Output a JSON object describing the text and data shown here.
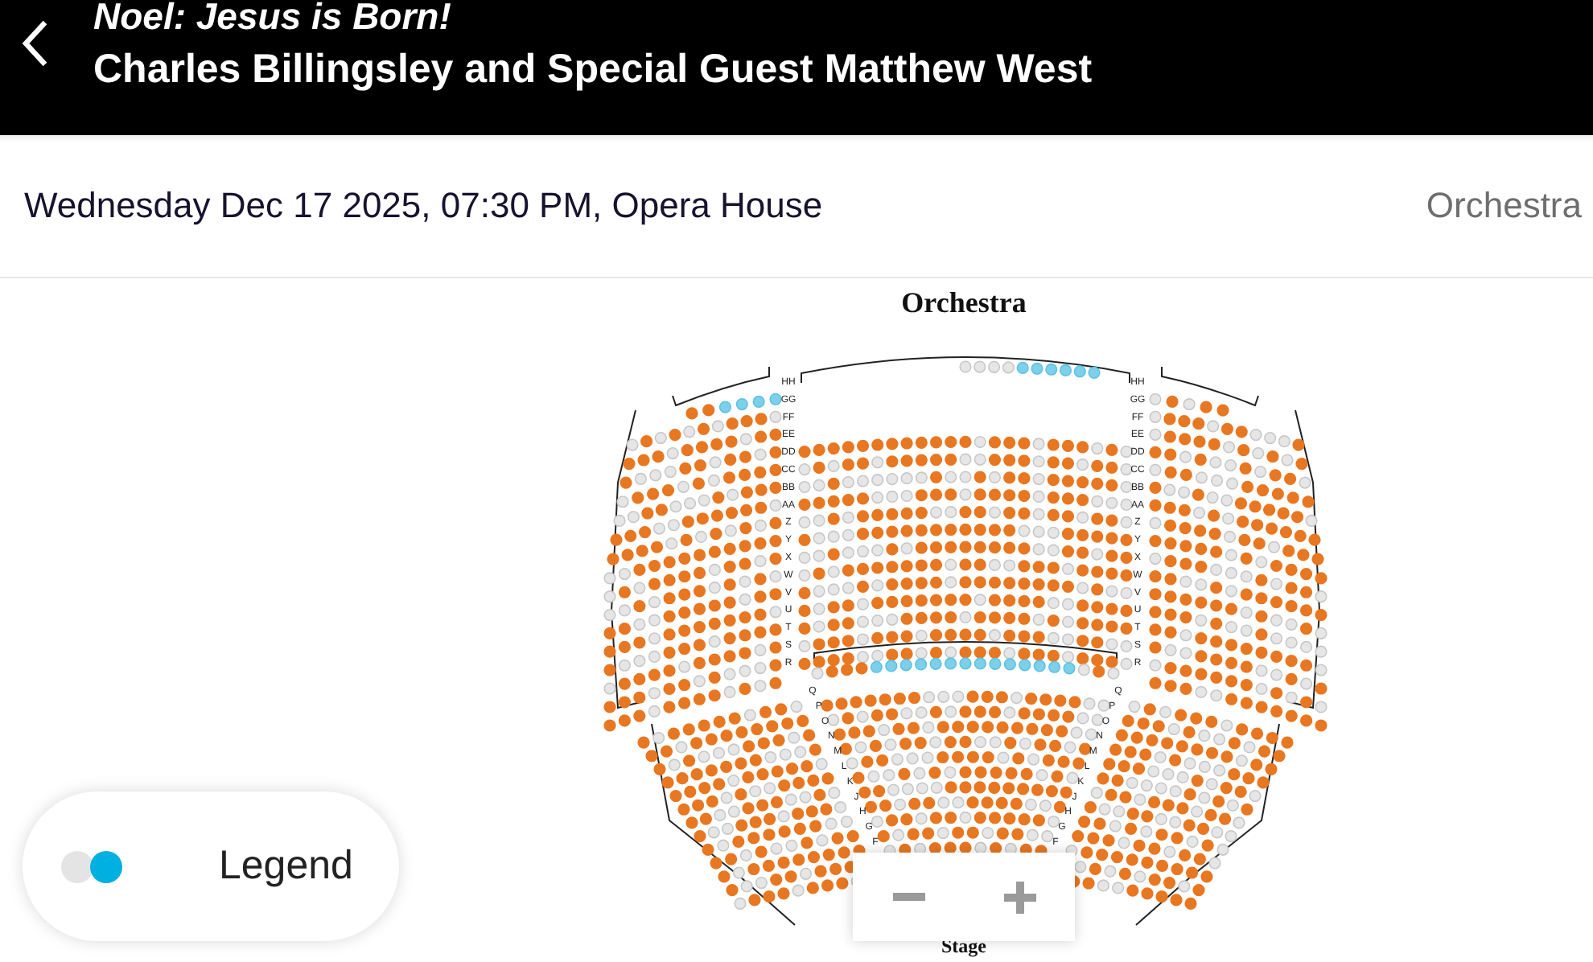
{
  "header": {
    "title": "Noel: Jesus is Born!",
    "subtitle": "Charles Billingsley and Special Guest Matthew West"
  },
  "event": {
    "details": "Wednesday Dec 17 2025, 07:30 PM, Opera House",
    "section": "Orchestra"
  },
  "map": {
    "title": "Orchestra",
    "upper_rows_left": [
      "HH",
      "GG",
      "FF",
      "EE",
      "DD",
      "CC",
      "BB",
      "AA",
      "Z",
      "Y",
      "X",
      "W",
      "V",
      "U",
      "T",
      "S",
      "R"
    ],
    "upper_rows_right": [
      "HH",
      "GG",
      "FF",
      "EE",
      "DD",
      "CC",
      "BB",
      "AA",
      "Z",
      "Y",
      "X",
      "W",
      "V",
      "U",
      "T",
      "S",
      "R"
    ],
    "lower_rows_left": [
      "Q",
      "P",
      "O",
      "N",
      "M",
      "L",
      "K",
      "J",
      "H",
      "G",
      "F"
    ],
    "lower_rows_right": [
      "Q",
      "P",
      "O",
      "N",
      "M",
      "L",
      "K",
      "J",
      "H",
      "G",
      "F"
    ],
    "stage_label": "Stage"
  },
  "legend": {
    "label": "Legend",
    "on": true
  }
}
